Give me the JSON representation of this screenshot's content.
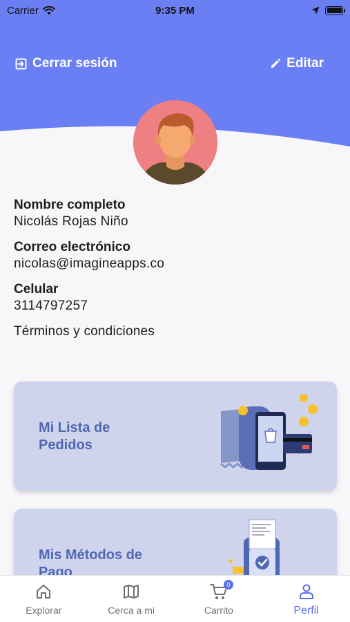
{
  "status_bar": {
    "carrier": "Carrier",
    "time": "9:35 PM"
  },
  "header": {
    "logout_label": "Cerrar sesión",
    "edit_label": "Editar"
  },
  "colors": {
    "primary": "#6b7ff5",
    "card_bg": "#cfd3ec",
    "card_text": "#4e68b3",
    "tab_active": "#5c6ef0",
    "tab_inactive": "#6f6f72"
  },
  "profile": {
    "fields": [
      {
        "label": "Nombre completo",
        "value": "Nicolás Rojas Niño"
      },
      {
        "label": "Correo electrónico",
        "value": "nicolas@imagineapps.co"
      },
      {
        "label": "Celular",
        "value": "3114797257"
      }
    ],
    "terms_label": "Términos y condiciones"
  },
  "cards": [
    {
      "title": "Mi Lista de Pedidos",
      "illustration": "shopping-receipt-phone-illustration"
    },
    {
      "title": "Mis Métodos de Pago",
      "illustration": "payment-terminal-illustration"
    }
  ],
  "tab_bar": {
    "items": [
      {
        "label": "Explorar",
        "icon": "home-icon"
      },
      {
        "label": "Cerca a mi",
        "icon": "map-icon"
      },
      {
        "label": "Carrito",
        "icon": "cart-icon",
        "badge": "0"
      },
      {
        "label": "Perfil",
        "icon": "person-icon",
        "active": true
      }
    ]
  }
}
